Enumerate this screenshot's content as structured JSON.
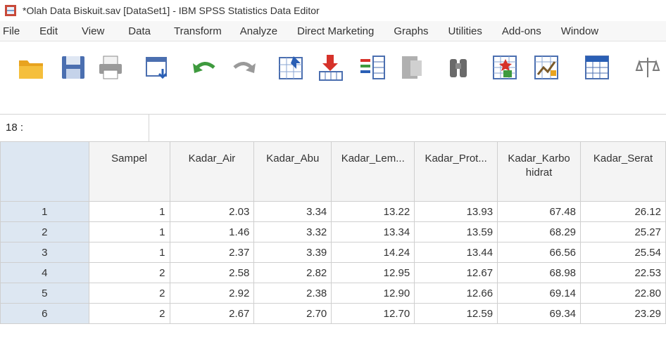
{
  "window": {
    "title": "*Olah Data Biskuit.sav [DataSet1] - IBM SPSS Statistics Data Editor"
  },
  "menu": [
    {
      "label": "File"
    },
    {
      "label": "Edit"
    },
    {
      "label": "View"
    },
    {
      "label": "Data"
    },
    {
      "label": "Transform"
    },
    {
      "label": "Analyze"
    },
    {
      "label": "Direct Marketing"
    },
    {
      "label": "Graphs"
    },
    {
      "label": "Utilities"
    },
    {
      "label": "Add-ons"
    },
    {
      "label": "Window"
    }
  ],
  "toolbar": {
    "icons": [
      "open-folder-icon",
      "save-icon",
      "print-icon",
      "recall-dialog-icon",
      "undo-icon",
      "redo-icon",
      "goto-case-icon",
      "goto-variable-icon",
      "variables-icon",
      "run-descriptive-icon",
      "find-icon",
      "insert-cases-icon",
      "insert-variable-icon",
      "split-file-icon",
      "weight-cases-icon"
    ]
  },
  "cell_editor": {
    "reference": "18 :",
    "value": ""
  },
  "grid": {
    "columns": [
      "Sampel",
      "Kadar_Air",
      "Kadar_Abu",
      "Kadar_Lem...",
      "Kadar_Prot...",
      "Kadar_Karbo hidrat",
      "Kadar_Serat"
    ],
    "rows": [
      {
        "id": "1",
        "cells": [
          "1",
          "2.03",
          "3.34",
          "13.22",
          "13.93",
          "67.48",
          "26.12"
        ]
      },
      {
        "id": "2",
        "cells": [
          "1",
          "1.46",
          "3.32",
          "13.34",
          "13.59",
          "68.29",
          "25.27"
        ]
      },
      {
        "id": "3",
        "cells": [
          "1",
          "2.37",
          "3.39",
          "14.24",
          "13.44",
          "66.56",
          "25.54"
        ]
      },
      {
        "id": "4",
        "cells": [
          "2",
          "2.58",
          "2.82",
          "12.95",
          "12.67",
          "68.98",
          "22.53"
        ]
      },
      {
        "id": "5",
        "cells": [
          "2",
          "2.92",
          "2.38",
          "12.90",
          "12.66",
          "69.14",
          "22.80"
        ]
      },
      {
        "id": "6",
        "cells": [
          "2",
          "2.67",
          "2.70",
          "12.70",
          "12.59",
          "69.34",
          "23.29"
        ]
      }
    ]
  },
  "colors": {
    "row_header": "#dde7f2",
    "column_header": "#f4f4f4",
    "grid_line": "#cfcfcf"
  }
}
